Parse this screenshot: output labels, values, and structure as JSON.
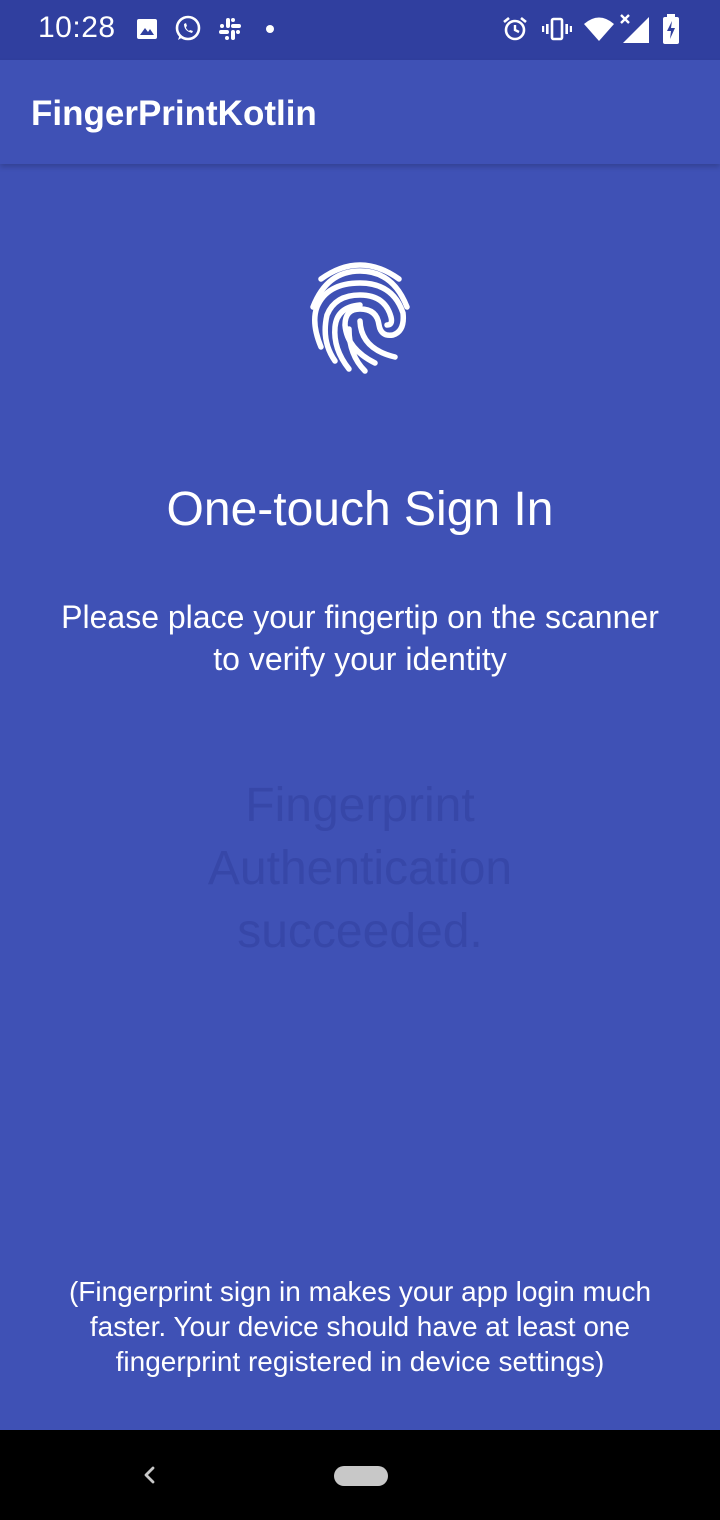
{
  "status_bar": {
    "time": "10:28",
    "left_icons": [
      "image-icon",
      "whatsapp-icon",
      "slack-icon",
      "dot-icon"
    ],
    "right_icons": [
      "alarm-icon",
      "vibrate-icon",
      "wifi-icon",
      "signal-icon",
      "battery-icon"
    ]
  },
  "app_bar": {
    "title": "FingerPrintKotlin"
  },
  "content": {
    "icon": "fingerprint-icon",
    "headline": "One-touch Sign In",
    "instruction": "Please place your fingertip on the scanner to verify your identity",
    "status_message": "Fingerprint Authentication succeeded.",
    "footnote": "(Fingerprint sign in makes your app login much faster. Your device should have at least one fingerprint registered in device settings)"
  },
  "nav_bar": {
    "icons": [
      "back-icon",
      "home-pill-icon"
    ]
  },
  "colors": {
    "primary": "#3f51b5",
    "primary_dark": "#303f9f",
    "status_message": "#3747a8",
    "text": "#ffffff"
  }
}
